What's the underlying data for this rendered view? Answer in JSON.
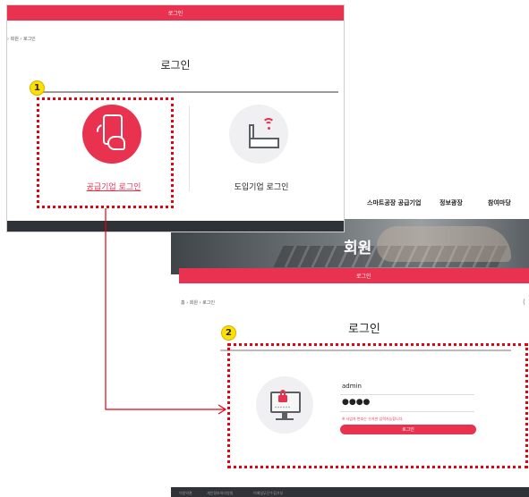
{
  "member_page": {
    "nav": [
      "스마트공장 공급기업",
      "정보광장",
      "참여마당"
    ],
    "hero_title": "회원",
    "red_bar_label": "로그인",
    "breadcrumb": "홈 › 회원 › 로그인",
    "title": "로그인",
    "id_value": "admin",
    "password_value": "●●●●",
    "password_icon_text": "******",
    "notice": "※ 사업자 번호는 숫자만 입력가능합니다.",
    "login_button": "로그인",
    "footer_links": [
      "이용약관",
      "개인정보처리방침",
      "이메일무단수집거부"
    ]
  },
  "login_select_page": {
    "top_bar_label": "로그인",
    "breadcrumb": "› 회원 › 로그인",
    "title": "로그인",
    "supplier_label": "공급기업 로그인",
    "importer_label": "도입기업 로그인"
  },
  "annotations": {
    "step1": "1",
    "step2": "2"
  },
  "colors": {
    "brand": "#e8324f",
    "annotation": "#e60012",
    "badge": "#ffe100"
  },
  "icons": [
    "smartphone-hand-icon",
    "factory-wifi-icon",
    "monitor-lock-icon"
  ]
}
